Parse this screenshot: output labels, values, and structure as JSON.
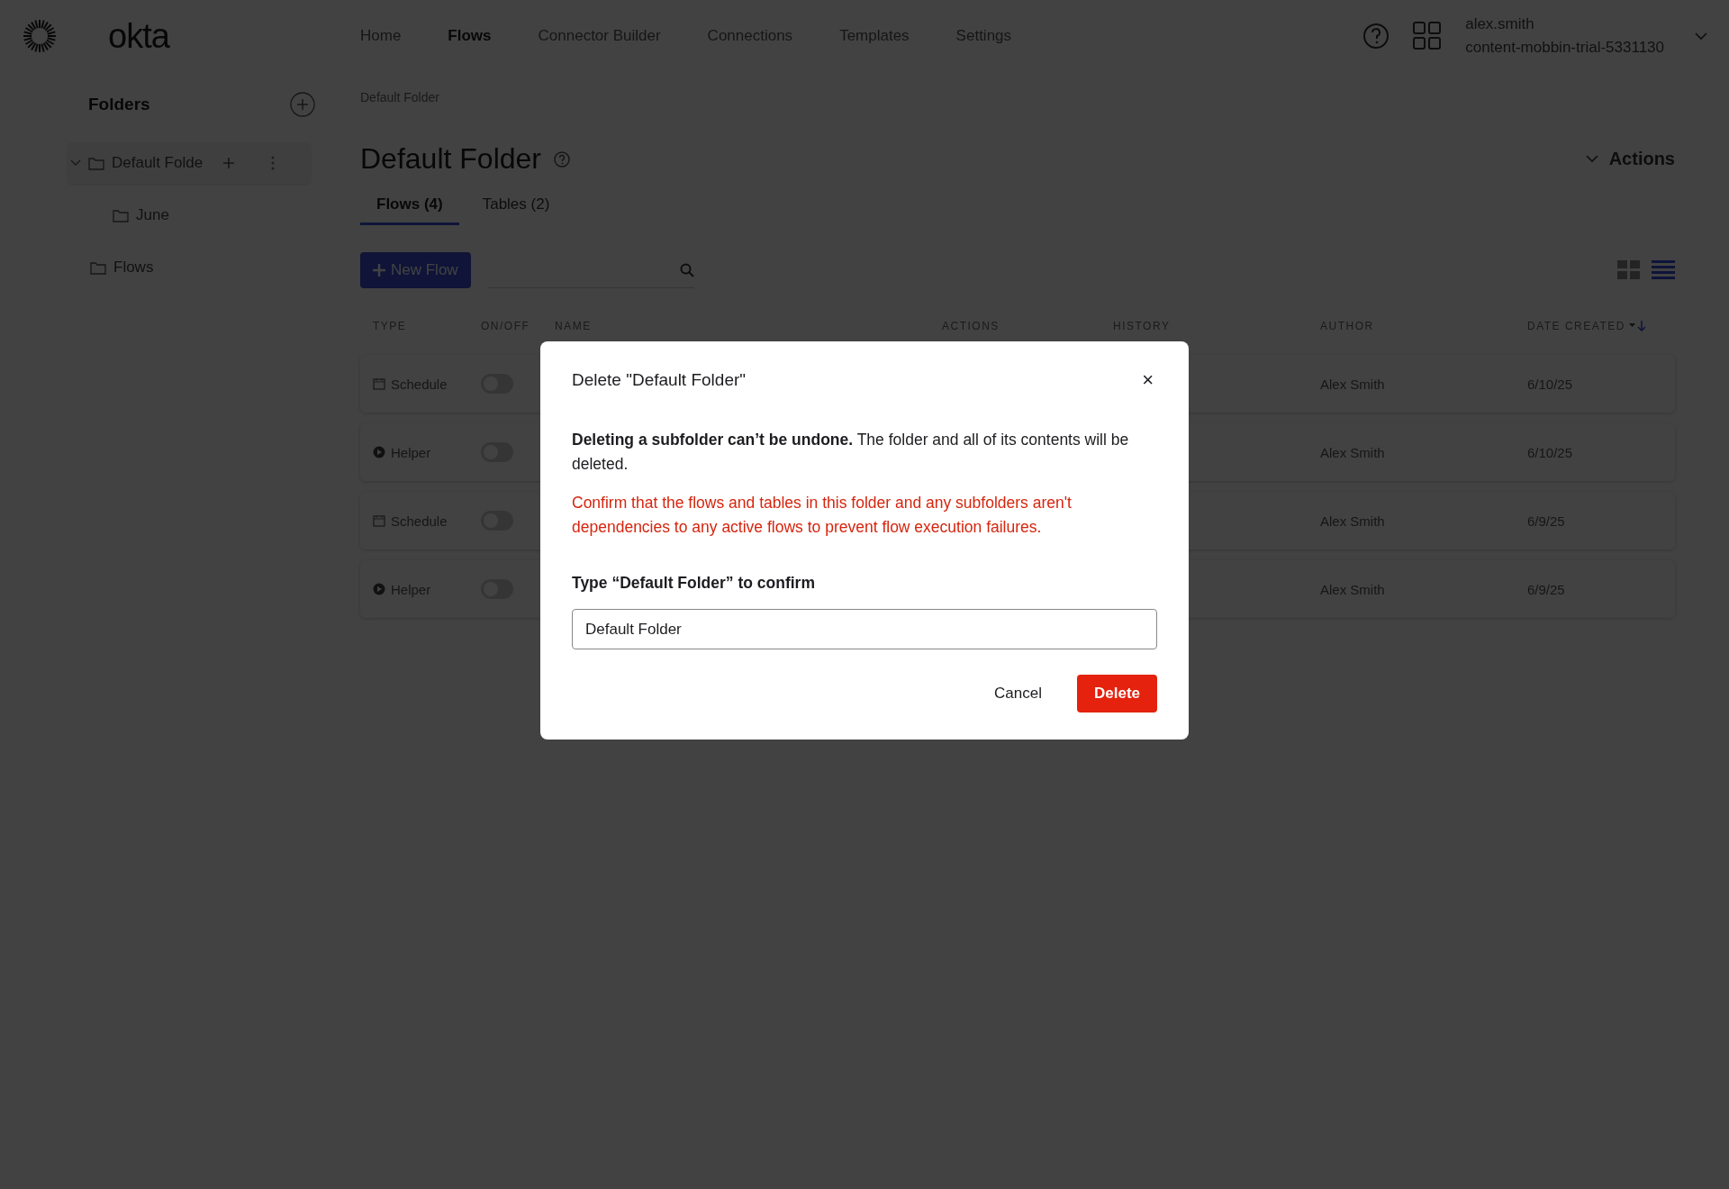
{
  "top_bar": {
    "logo": "okta",
    "nav": [
      {
        "label": "Home",
        "selected": false
      },
      {
        "label": "Flows",
        "selected": true
      },
      {
        "label": "Connector Builder",
        "selected": false
      },
      {
        "label": "Connections",
        "selected": false
      },
      {
        "label": "Templates",
        "selected": false
      },
      {
        "label": "Settings",
        "selected": false
      }
    ],
    "user": {
      "name": "alex.smith",
      "org": "content-mobbin-trial-5331130"
    }
  },
  "sidebar": {
    "title": "Folders",
    "folders": [
      {
        "label": "Default Folde",
        "selected": true,
        "expanded": true,
        "children": [
          {
            "label": "June",
            "selected": false
          }
        ]
      },
      {
        "label": "Flows",
        "selected": false
      }
    ]
  },
  "main": {
    "breadcrumb": "Default Folder",
    "title": "Default Folder",
    "actions": "Actions",
    "tabs": [
      {
        "label": "Flows (4)",
        "selected": true
      },
      {
        "label": "Tables (2)",
        "selected": false
      }
    ],
    "new_button": "New Flow",
    "table": {
      "columns": [
        "TYPE",
        "ON/OFF",
        "NAME",
        "ACTIONS",
        "HISTORY",
        "AUTHOR",
        "DATE CREATED"
      ],
      "rows": [
        {
          "kind": "schedule",
          "type": "Schedule",
          "on": false,
          "author": "Alex Smith",
          "date": "6/10/25"
        },
        {
          "kind": "helper",
          "type": "Helper",
          "on": false,
          "author": "Alex Smith",
          "date": "6/10/25"
        },
        {
          "kind": "schedule",
          "type": "Schedule",
          "on": false,
          "author": "Alex Smith",
          "date": "6/9/25"
        },
        {
          "kind": "helper",
          "type": "Helper",
          "on": false,
          "author": "Alex Smith",
          "date": "6/9/25"
        }
      ]
    }
  },
  "dialog": {
    "title": "Delete \"Default Folder\"",
    "close": "×",
    "message": "**Deleting a subfolder can’t be undone.** The folder and all of its contents will be deleted.",
    "warning": "Confirm that the flows and tables in this folder and any subfolders aren't dependencies to any active flows to prevent flow execution failures.",
    "field_label": "Type “Default Folder” to confirm",
    "field_value": "Default Folder",
    "buttons": [
      {
        "kind": "secondary",
        "label": "Cancel"
      },
      {
        "kind": "danger",
        "label": "Delete"
      }
    ]
  }
}
